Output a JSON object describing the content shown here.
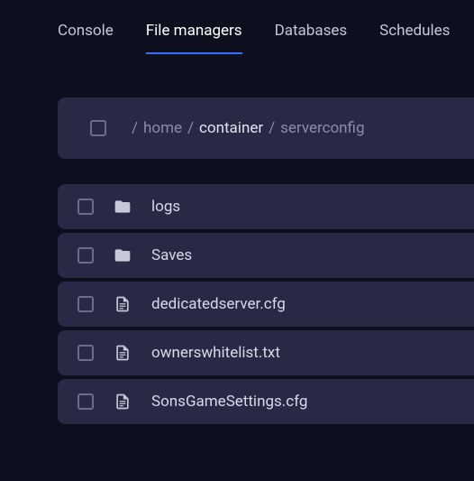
{
  "tabs": [
    {
      "label": "Console",
      "active": false
    },
    {
      "label": "File managers",
      "active": true
    },
    {
      "label": "Databases",
      "active": false
    },
    {
      "label": "Schedules",
      "active": false
    }
  ],
  "breadcrumb": {
    "segments": [
      {
        "label": "home",
        "active": false
      },
      {
        "label": "container",
        "active": true
      },
      {
        "label": "serverconfig",
        "active": false
      }
    ]
  },
  "files": [
    {
      "name": "logs",
      "type": "folder"
    },
    {
      "name": "Saves",
      "type": "folder"
    },
    {
      "name": "dedicatedserver.cfg",
      "type": "file"
    },
    {
      "name": "ownerswhitelist.txt",
      "type": "file"
    },
    {
      "name": "SonsGameSettings.cfg",
      "type": "file"
    }
  ]
}
